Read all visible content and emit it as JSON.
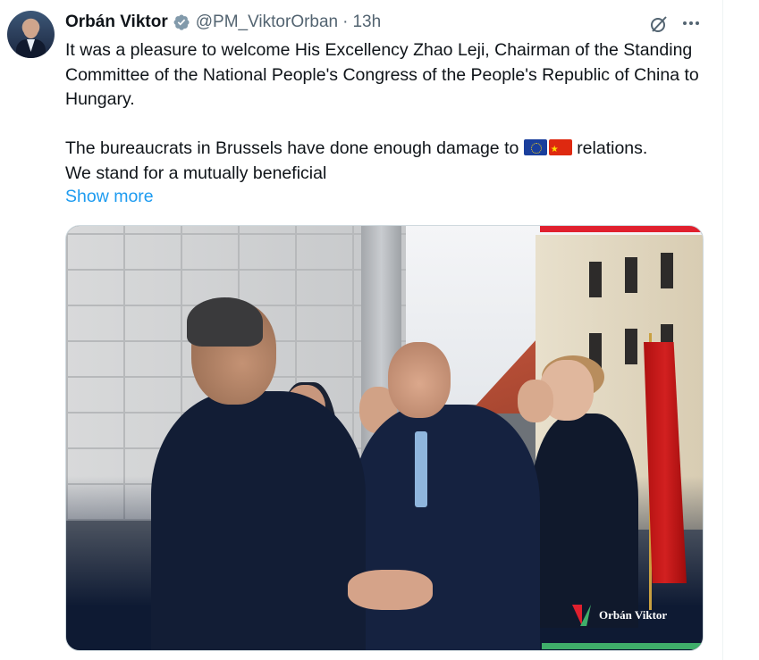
{
  "author": {
    "name": "Orbán Viktor",
    "handle": "@PM_ViktorOrban",
    "separator": "·",
    "time": "13h"
  },
  "tweet": {
    "line1": "It was a pleasure to welcome His Excellency Zhao Leji, Chairman of the Standing Committee of the National People's Congress of the People's Republic of China to Hungary.",
    "line2_before": "The bureaucrats in Brussels have done enough damage to",
    "line2_after": "relations.",
    "line3": "We stand for a mutually beneficial",
    "show_more": "Show more",
    "emoji": [
      "eu-flag-emoji",
      "china-flag-emoji"
    ]
  },
  "media": {
    "watermark": "Orbán Viktor"
  },
  "icons": {
    "verified": "verified-badge-icon",
    "grok": "grok-icon",
    "more": "more-options-icon"
  },
  "colors": {
    "link": "#1d9bf0",
    "secondary_text": "#536471",
    "verified_badge": "#829aab"
  }
}
